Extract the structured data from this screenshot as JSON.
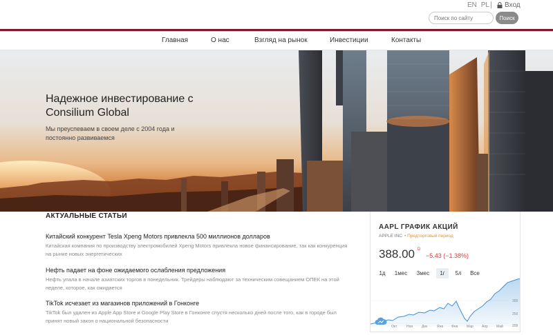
{
  "header": {
    "lang_en": "EN",
    "lang_pl": "PL",
    "separator": "|",
    "login_label": "Вход",
    "search_placeholder": "Поиск по сайту",
    "search_button": "Поиск"
  },
  "nav": {
    "items": [
      "Главная",
      "О нас",
      "Взгляд на рынок",
      "Инвестиции",
      "Контакты"
    ]
  },
  "hero": {
    "title": "Надежное инвестирование с Consilium Global",
    "subtitle": "Мы преуспеваем в своем деле с 2004 года и постоянно развиваемся"
  },
  "articles": {
    "heading": "АКТУАЛЬНЫЕ СТАТЬИ",
    "items": [
      {
        "title": "Китайский конкурент Tesla Xpeng Motors привлекла 500 миллионов долларов",
        "text": "Китайская компания по производству электромобилей Xpeng Motors привлекла новое финансирование, так как конкуренция на рынке новых энергетических"
      },
      {
        "title": "Нефть падает на фоне ожидаемого ослабления предложения",
        "text": "Нефть упала в начале азиатских торгов в понедельник. Трейдеры наблюдают за техническим совещанием ОПЕК на этой неделе, которое, как ожидается"
      },
      {
        "title": "TikTok исчезает из магазинов приложений в Гонконге",
        "text": "TikTok был удален из Apple App Store и Google Play Store в Гонконге спустя несколько дней после того, как в городе был принят новый закон о национальной безопасности"
      }
    ]
  },
  "stock": {
    "title": "AAPL ГРАФИК АКЦИЙ",
    "company": "APPLE INC",
    "status": "• Предторговый период",
    "price": "388.00",
    "currency": "D",
    "change": "−5.43 (−1.38%)",
    "ranges": [
      "1д",
      "1мес",
      "3мес",
      "1г",
      "5л",
      "Все"
    ],
    "active_range": "1г",
    "x_labels": [
      "Окт",
      "Ноя",
      "Дек",
      "Янв",
      "Фев",
      "Мар",
      "Апр",
      "Май"
    ],
    "y_labels": [
      "300",
      "250",
      "200"
    ],
    "accent_color": "#3d8fd6",
    "down_color": "#d04040"
  },
  "colors": {
    "brand_line": "#7a1a2a"
  }
}
